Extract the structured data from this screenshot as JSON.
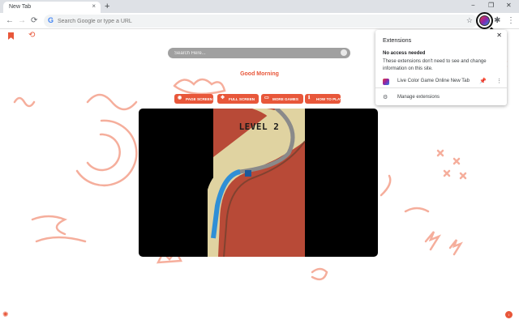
{
  "browser": {
    "tab_title": "New Tab",
    "tab_close": "×",
    "new_tab": "+",
    "minimize": "−",
    "restore": "❐",
    "close": "✕",
    "back": "←",
    "forward": "→",
    "reload": "⟳",
    "omnibox_placeholder": "Search Google or type a URL",
    "google_g": "G",
    "star": "☆",
    "puzzle": "✱",
    "kebab": "⋮"
  },
  "page": {
    "search_placeholder": "Search Here...",
    "greeting": "Good Morning",
    "history_icon": "⟲",
    "gear_icon": "✺",
    "corner_badge": "i",
    "buttons": [
      {
        "icon": "◉",
        "label": "PAGE SCREEN"
      },
      {
        "icon": "✥",
        "label": "FULL SCREEN"
      },
      {
        "icon": "▭",
        "label": "MORE GAMES"
      },
      {
        "icon": "ℹ",
        "label": "HOW TO PLAY"
      }
    ],
    "game": {
      "level_text": "LEVEL 2"
    },
    "accent_color": "#e8573a"
  },
  "extensions_popup": {
    "title": "Extensions",
    "close": "✕",
    "heading": "No access needed",
    "description": "These extensions don't need to see and change information on this site.",
    "extension_name": "Live Color Game Online New Tab",
    "pin": "📌",
    "row_menu": "⋮",
    "manage_icon": "⚙",
    "manage_label": "Manage extensions"
  }
}
